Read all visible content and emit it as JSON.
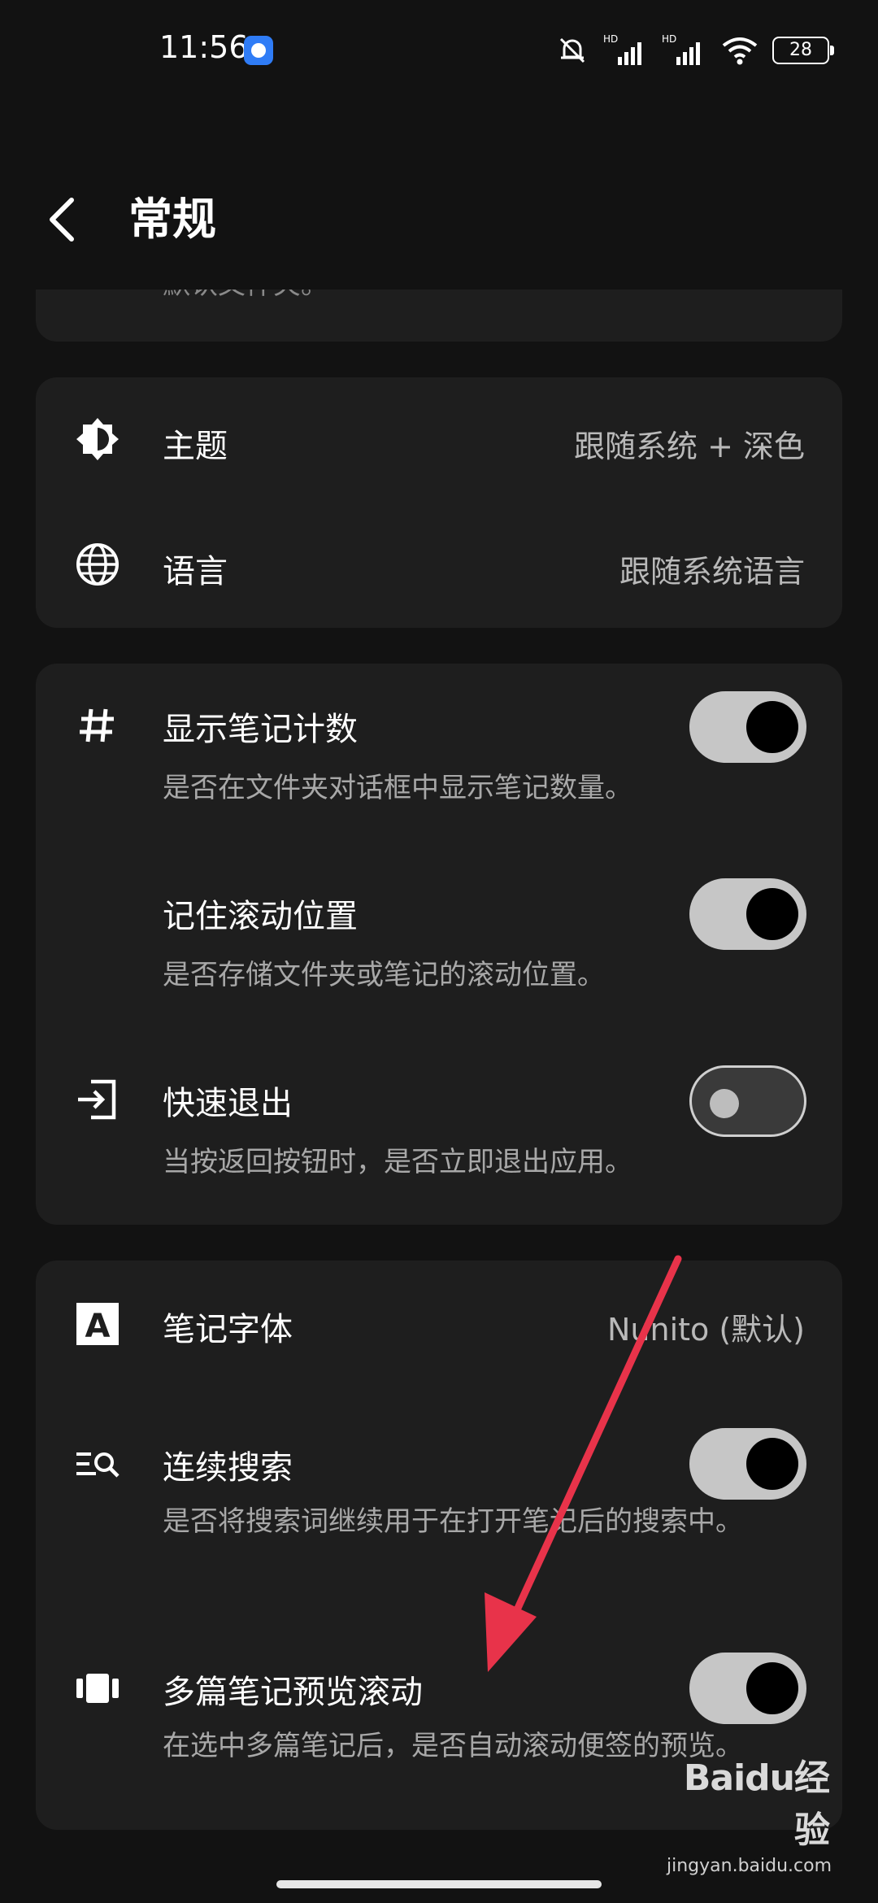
{
  "status_bar": {
    "time": "11:56",
    "battery": "28",
    "signal_label": "HD"
  },
  "header": {
    "title": "常规"
  },
  "top_card": {
    "clipped_text": "默认文件夹。"
  },
  "appearance_card": {
    "theme_label": "主题",
    "theme_value": "跟随系统 + 深色",
    "language_label": "语言",
    "language_value": "跟随系统语言"
  },
  "behavior_card": {
    "note_count_label": "显示笔记计数",
    "note_count_desc": "是否在文件夹对话框中显示笔记数量。",
    "note_count_on": true,
    "scroll_pos_label": "记住滚动位置",
    "scroll_pos_desc": "是否存储文件夹或笔记的滚动位置。",
    "scroll_pos_on": true,
    "quick_exit_label": "快速退出",
    "quick_exit_desc": "当按返回按钮时，是否立即退出应用。",
    "quick_exit_on": false
  },
  "editor_card": {
    "font_label": "笔记字体",
    "font_value": "Nunito (默认)",
    "continuous_search_label": "连续搜索",
    "continuous_search_desc": "是否将搜索词继续用于在打开笔记后的搜索中。",
    "continuous_search_on": true,
    "multi_preview_label": "多篇笔记预览滚动",
    "multi_preview_desc": "在选中多篇笔记后，是否自动滚动便签的预览。",
    "multi_preview_on": true
  },
  "watermark": {
    "brand": "Baidu经验",
    "site": "jingyan.baidu.com"
  },
  "colors": {
    "background": "#121212",
    "card": "#1e1e1e",
    "toggle_on_track": "#c6c6c6",
    "annotation_arrow": "#e8334a"
  }
}
